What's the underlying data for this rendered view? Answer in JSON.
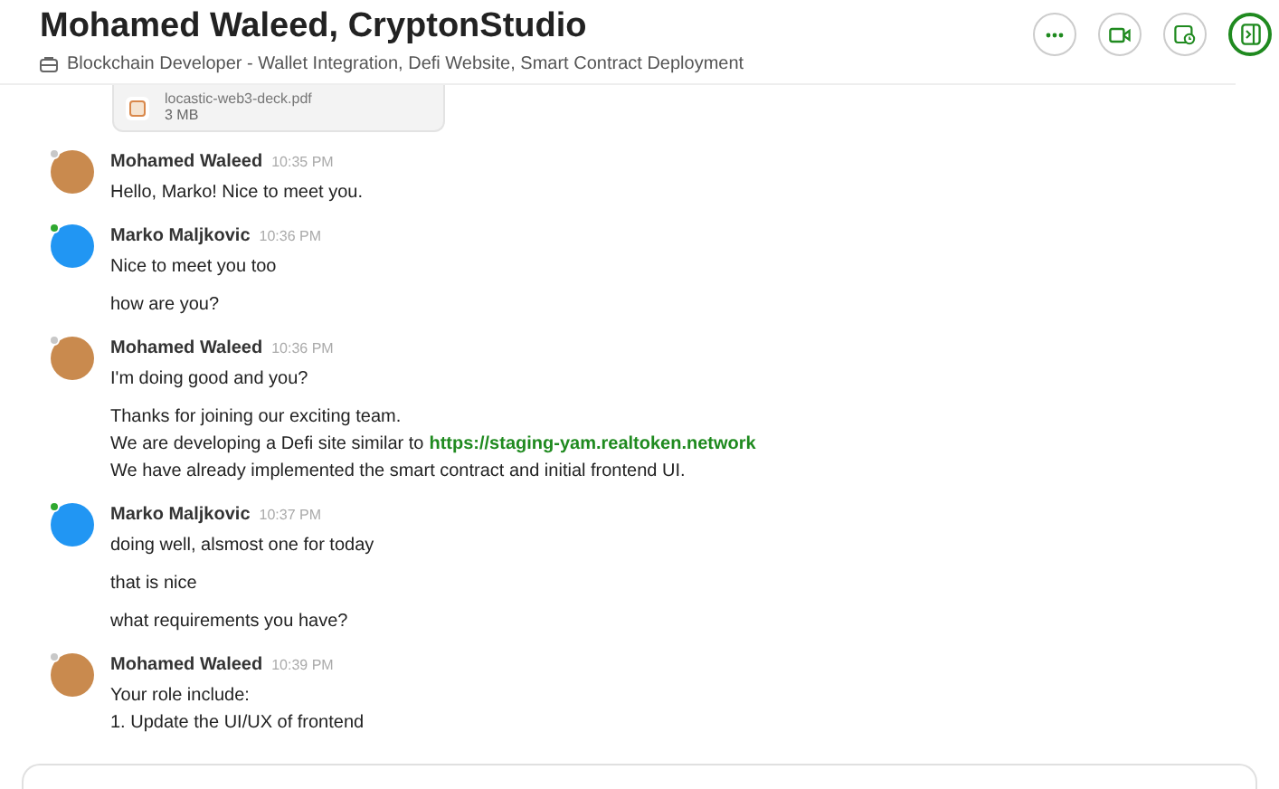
{
  "header": {
    "title": "Mohamed Waleed, CryptonStudio",
    "subtitle": "Blockchain Developer - Wallet Integration, Defi Website, Smart Contract Deployment"
  },
  "attachment": {
    "file_name": "locastic-web3-deck.pdf",
    "size": "3 MB"
  },
  "messages": [
    {
      "author": "Mohamed Waleed",
      "time": "10:35 PM",
      "online": false,
      "kind": "client",
      "lines": [
        [
          {
            "text": "Hello, Marko! Nice to meet you."
          }
        ]
      ]
    },
    {
      "author": "Marko Maljkovic",
      "time": "10:36 PM",
      "online": true,
      "kind": "freelancer",
      "lines": [
        [
          {
            "text": "Nice to meet you too"
          }
        ],
        [
          {
            "text": "how are you?"
          }
        ]
      ]
    },
    {
      "author": "Mohamed Waleed",
      "time": "10:36 PM",
      "online": false,
      "kind": "client",
      "lines": [
        [
          {
            "text": "I'm doing good and you?"
          }
        ],
        [
          {
            "text": "Thanks for joining our exciting team."
          },
          {
            "text": "We are developing a Defi site similar to",
            "link": "https://staging-yam.realtoken.network"
          },
          {
            "text": "We have already implemented the smart contract and initial frontend UI."
          }
        ]
      ]
    },
    {
      "author": "Marko Maljkovic",
      "time": "10:37 PM",
      "online": true,
      "kind": "freelancer",
      "lines": [
        [
          {
            "text": "doing well, alsmost one for today"
          }
        ],
        [
          {
            "text": "that is nice"
          }
        ],
        [
          {
            "text": "what requirements you have?"
          }
        ]
      ]
    },
    {
      "author": "Mohamed Waleed",
      "time": "10:39 PM",
      "online": false,
      "kind": "client",
      "lines": [
        [
          {
            "text": "Your role include:"
          },
          {
            "text": "1. Update the UI/UX of frontend"
          }
        ]
      ]
    }
  ]
}
